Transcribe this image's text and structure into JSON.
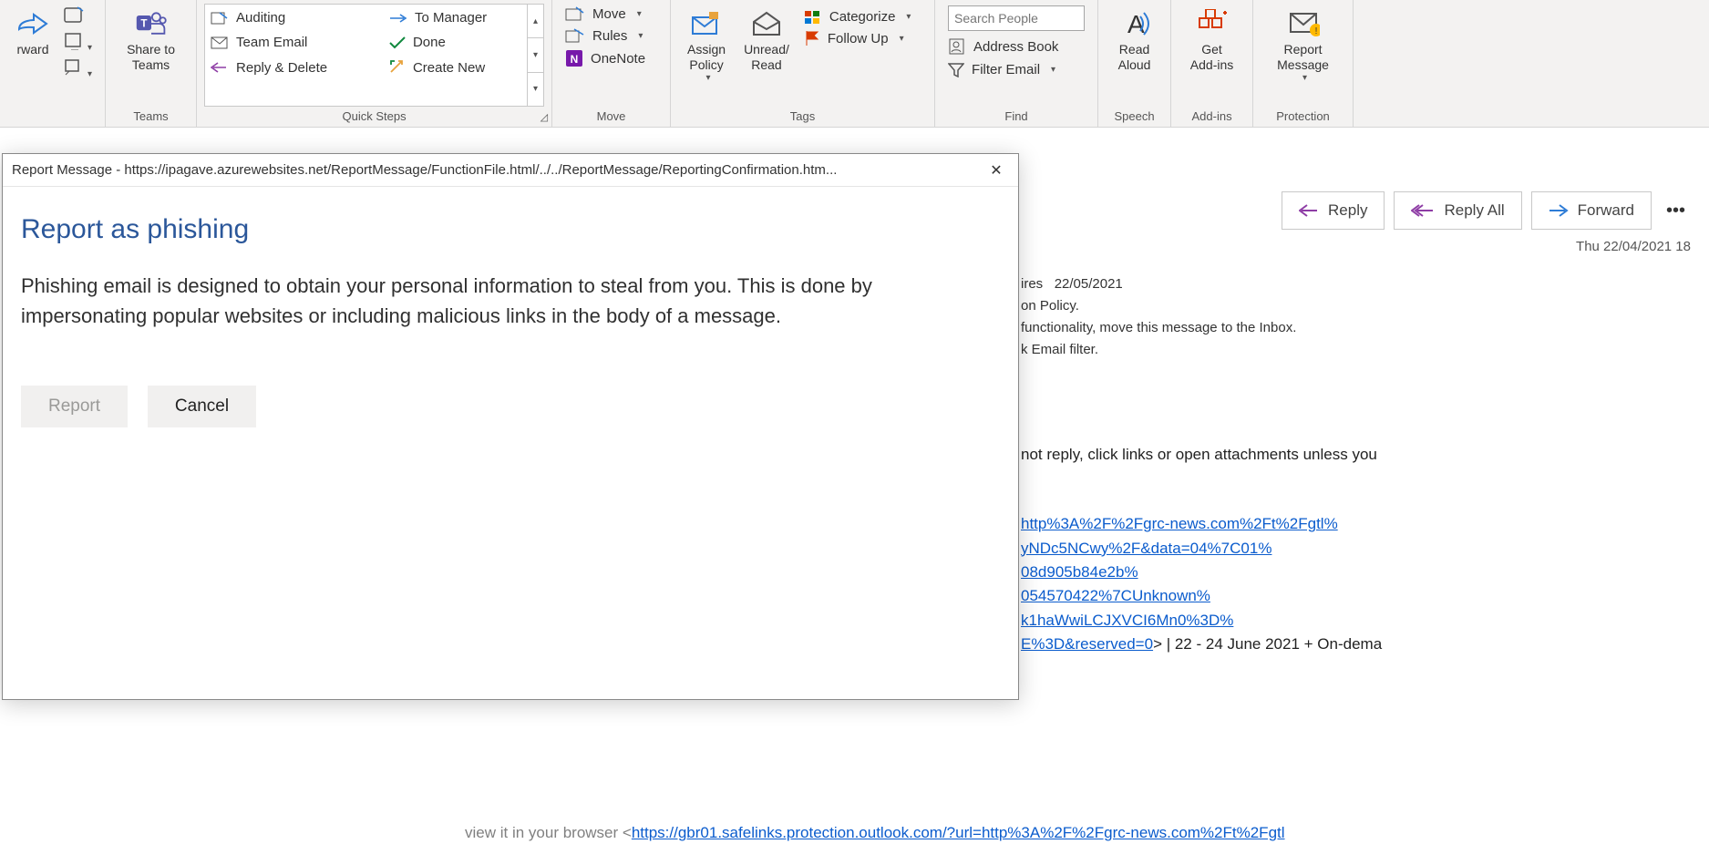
{
  "ribbon": {
    "forward_label": "rward",
    "share_to_teams": "Share to\nTeams",
    "quicksteps": {
      "auditing": "Auditing",
      "team_email": "Team Email",
      "reply_delete": "Reply & Delete",
      "to_manager": "To Manager",
      "done": "Done",
      "create_new": "Create New"
    },
    "move": "Move",
    "rules": "Rules",
    "onenote": "OneNote",
    "assign_policy": "Assign\nPolicy",
    "unread_read": "Unread/\nRead",
    "categorize": "Categorize",
    "follow_up": "Follow Up",
    "search_people_placeholder": "Search People",
    "address_book": "Address Book",
    "filter_email": "Filter Email",
    "read_aloud": "Read\nAloud",
    "get_addins": "Get\nAdd-ins",
    "report_message": "Report\nMessage",
    "groups": {
      "teams": "Teams",
      "quicksteps": "Quick Steps",
      "move": "Move",
      "tags": "Tags",
      "find": "Find",
      "speech": "Speech",
      "addins": "Add-ins",
      "protection": "Protection"
    }
  },
  "message": {
    "actions": {
      "reply": "Reply",
      "reply_all": "Reply All",
      "forward": "Forward"
    },
    "date": "Thu 22/04/2021 18",
    "expires_label": "ires",
    "expires_date": "22/05/2021",
    "info_line1": "on Policy.",
    "info_line2": " functionality, move this message to the Inbox.",
    "info_line3": "k Email filter.",
    "warn": "not reply, click links or open attachments unless you",
    "link1": "http%3A%2F%2Fgrc-news.com%2Ft%2Fgtl%",
    "link2": "yNDc5NCwy%2F&data=04%7C01%",
    "link3": "08d905b84e2b%",
    "link4": "054570422%7CUnknown%",
    "link5": "k1haWwiLCJXVCI6Mn0%3D%",
    "link6": "E%3D&reserved=0",
    "tail": ">  |  22 - 24 June 2021 + On-dema",
    "browser_pre": "view it in your browser <",
    "browser_link": "https://gbr01.safelinks.protection.outlook.com/?url=http%3A%2F%2Fgrc-news.com%2Ft%2Fgtl"
  },
  "dialog": {
    "title": "Report Message - https://ipagave.azurewebsites.net/ReportMessage/FunctionFile.html/../../ReportMessage/ReportingConfirmation.htm...",
    "heading": "Report as phishing",
    "body": "Phishing email is designed to obtain your personal information to steal from you. This is done by impersonating popular websites or including malicious links in the body of a message.",
    "report": "Report",
    "cancel": "Cancel"
  }
}
